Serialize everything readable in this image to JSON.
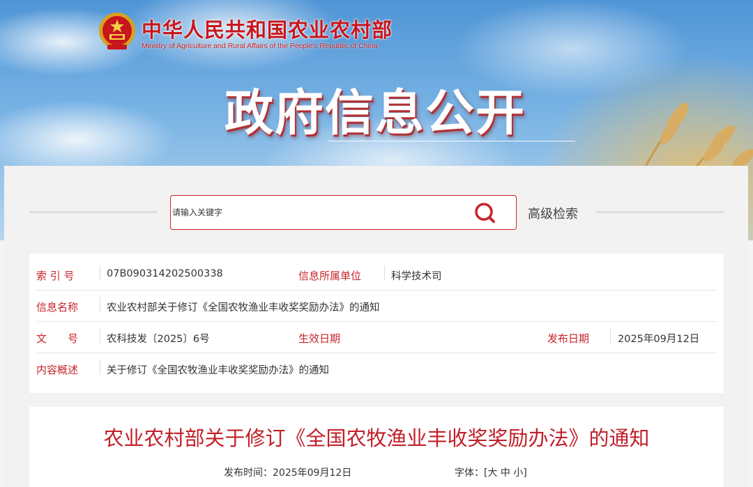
{
  "header": {
    "ministry_cn": "中华人民共和国农业农村部",
    "ministry_en": "Ministry of Agriculture and Rural Affairs of the People's Republic of China",
    "section_title": "政府信息公开",
    "brand_color": "#c8161d"
  },
  "search": {
    "placeholder": "请输入关键字",
    "button_icon": "search-icon",
    "advanced_label": "高级检索"
  },
  "meta": {
    "index_label": "索 引 号",
    "index_value": "07B090314202500338",
    "unit_label": "信息所属单位",
    "unit_value": "科学技术司",
    "name_label": "信息名称",
    "name_value": "农业农村部关于修订《全国农牧渔业丰收奖奖励办法》的通知",
    "docno_label": "文　　号",
    "docno_value": "农科技发〔2025〕6号",
    "effective_label": "生效日期",
    "effective_value": "",
    "pubdate_label": "发布日期",
    "pubdate_value": "2025年09月12日",
    "summary_label": "内容概述",
    "summary_value": "关于修订《全国农牧渔业丰收奖奖励办法》的通知"
  },
  "article": {
    "title": "农业农村部关于修订《全国农牧渔业丰收奖奖励办法》的通知",
    "pub_label": "发布时间：",
    "pub_value": "2025年09月12日",
    "font_label": "字体：[",
    "font_large": "大",
    "font_medium": "中",
    "font_small": "小",
    "font_end": "]"
  },
  "colors": {
    "accent": "#c8242a",
    "title_red": "#c0202a"
  }
}
